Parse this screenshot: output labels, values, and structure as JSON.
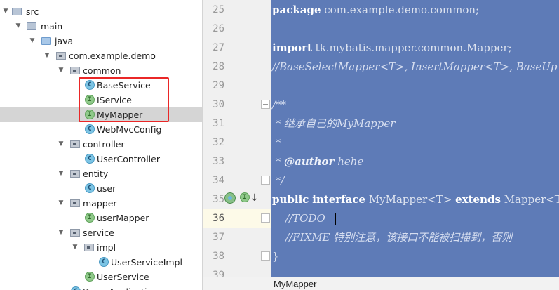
{
  "project_tree": {
    "items": [
      {
        "label": "src",
        "icon": "folder-icon"
      },
      {
        "label": "main",
        "icon": "folder-icon"
      },
      {
        "label": "java",
        "icon": "source-folder-icon"
      },
      {
        "label": "com.example.demo",
        "icon": "package-icon"
      },
      {
        "label": "common",
        "icon": "package-icon"
      },
      {
        "label": "BaseService",
        "icon": "class-icon"
      },
      {
        "label": "IService",
        "icon": "interface-icon"
      },
      {
        "label": "MyMapper",
        "icon": "interface-icon"
      },
      {
        "label": "WebMvcConfig",
        "icon": "class-icon"
      },
      {
        "label": "controller",
        "icon": "package-icon"
      },
      {
        "label": "UserController",
        "icon": "class-icon"
      },
      {
        "label": "entity",
        "icon": "package-icon"
      },
      {
        "label": "user",
        "icon": "class-icon"
      },
      {
        "label": "mapper",
        "icon": "package-icon"
      },
      {
        "label": "userMapper",
        "icon": "interface-icon"
      },
      {
        "label": "service",
        "icon": "package-icon"
      },
      {
        "label": "impl",
        "icon": "package-icon"
      },
      {
        "label": "UserServiceImpl",
        "icon": "class-icon"
      },
      {
        "label": "UserService",
        "icon": "interface-icon"
      },
      {
        "label": "DemoApplication",
        "icon": "class-icon"
      }
    ],
    "selected": "MyMapper",
    "badge_class": "C",
    "badge_interface": "I"
  },
  "editor": {
    "line_numbers": [
      "25",
      "26",
      "27",
      "28",
      "29",
      "30",
      "31",
      "32",
      "33",
      "34",
      "35",
      "36",
      "37",
      "38",
      "39"
    ],
    "current_line": "36",
    "lines": {
      "l25": {
        "kw": "package",
        "rest": " com.example.demo.common;"
      },
      "l27": {
        "kw": "import",
        "rest": " tk.mybatis.mapper.common.Mapper;"
      },
      "l28": {
        "comment": "//BaseSelectMapper<T>, InsertMapper<T>, BaseUp"
      },
      "l30": {
        "comment": "/**"
      },
      "l31": {
        "comment": " * 继承自己的MyMapper"
      },
      "l32": {
        "comment": " *"
      },
      "l33": {
        "pre": " * ",
        "tag": "@author",
        "rest": " hehe"
      },
      "l34": {
        "comment": " */"
      },
      "l35": {
        "kw1": "public",
        "sp1": " ",
        "kw2": "interface",
        "mid": " MyMapper<T> ",
        "kw3": "extends",
        "rest": " Mapper<T>"
      },
      "l36": {
        "comment": "    //TODO"
      },
      "l37": {
        "comment": "    //FIXME 特别注意，该接口不能被扫描到，否则"
      },
      "l38": {
        "text": "}"
      }
    },
    "gutter_icons": [
      "implemented-icon",
      "interface-badge-icon",
      "overridden-arrow-icon"
    ]
  },
  "status_bar": {
    "breadcrumb": "MyMapper"
  },
  "colors": {
    "selection_bg": "#5e7bb7",
    "highlight_box": "#ea2727"
  }
}
